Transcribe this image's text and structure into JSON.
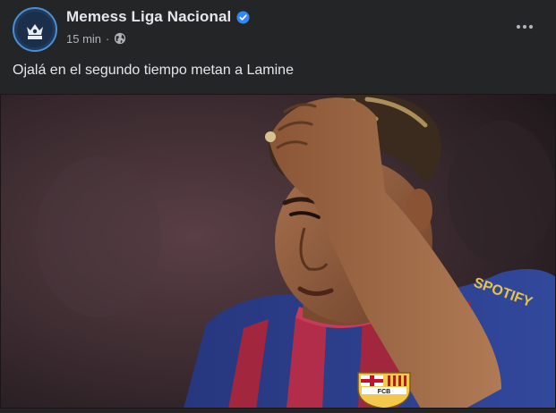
{
  "post": {
    "page_name": "Memess Liga Nacional",
    "verified": true,
    "timestamp": "15 min",
    "separator": "·",
    "audience_icon": "globe-icon",
    "more_icon": "more-horizontal-icon",
    "text": "Ojalá en el segundo tiempo metan a Lamine",
    "photo": {
      "crest_text": "FCB",
      "sponsor_text": "SPOTIFY"
    }
  },
  "colors": {
    "background": "#242526",
    "primary_text": "#e4e6eb",
    "secondary_text": "#b0b3b8",
    "verified_badge": "#2d88ff",
    "jersey_blue": "#2a3f8f",
    "jersey_red": "#a3263f"
  }
}
